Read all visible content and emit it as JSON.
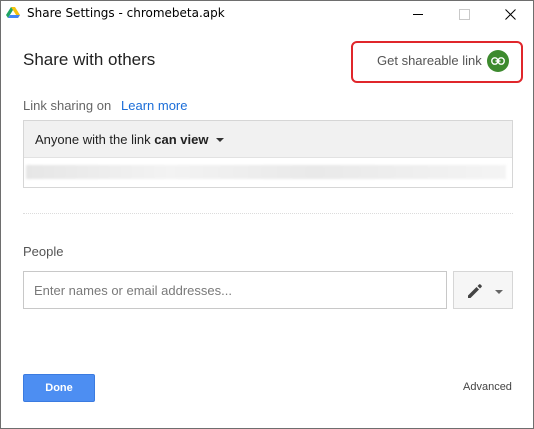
{
  "window": {
    "title": "Share Settings - chromebeta.apk"
  },
  "dialog": {
    "heading": "Share with others",
    "get_link_label": "Get shareable link",
    "link_sharing_label": "Link sharing on",
    "learn_more": "Learn more",
    "access_prefix": "Anyone with the link",
    "access_level": "can view",
    "people_label": "People",
    "people_placeholder": "Enter names or email addresses...",
    "done_label": "Done",
    "advanced_label": "Advanced"
  },
  "icons": {
    "app": "google-drive-icon",
    "link": "link-icon",
    "edit": "pencil-icon"
  },
  "colors": {
    "accent": "#4d8ef2",
    "link_button": "#3d8a2e",
    "highlight": "#e0262b",
    "link_text": "#1a6dd8"
  }
}
